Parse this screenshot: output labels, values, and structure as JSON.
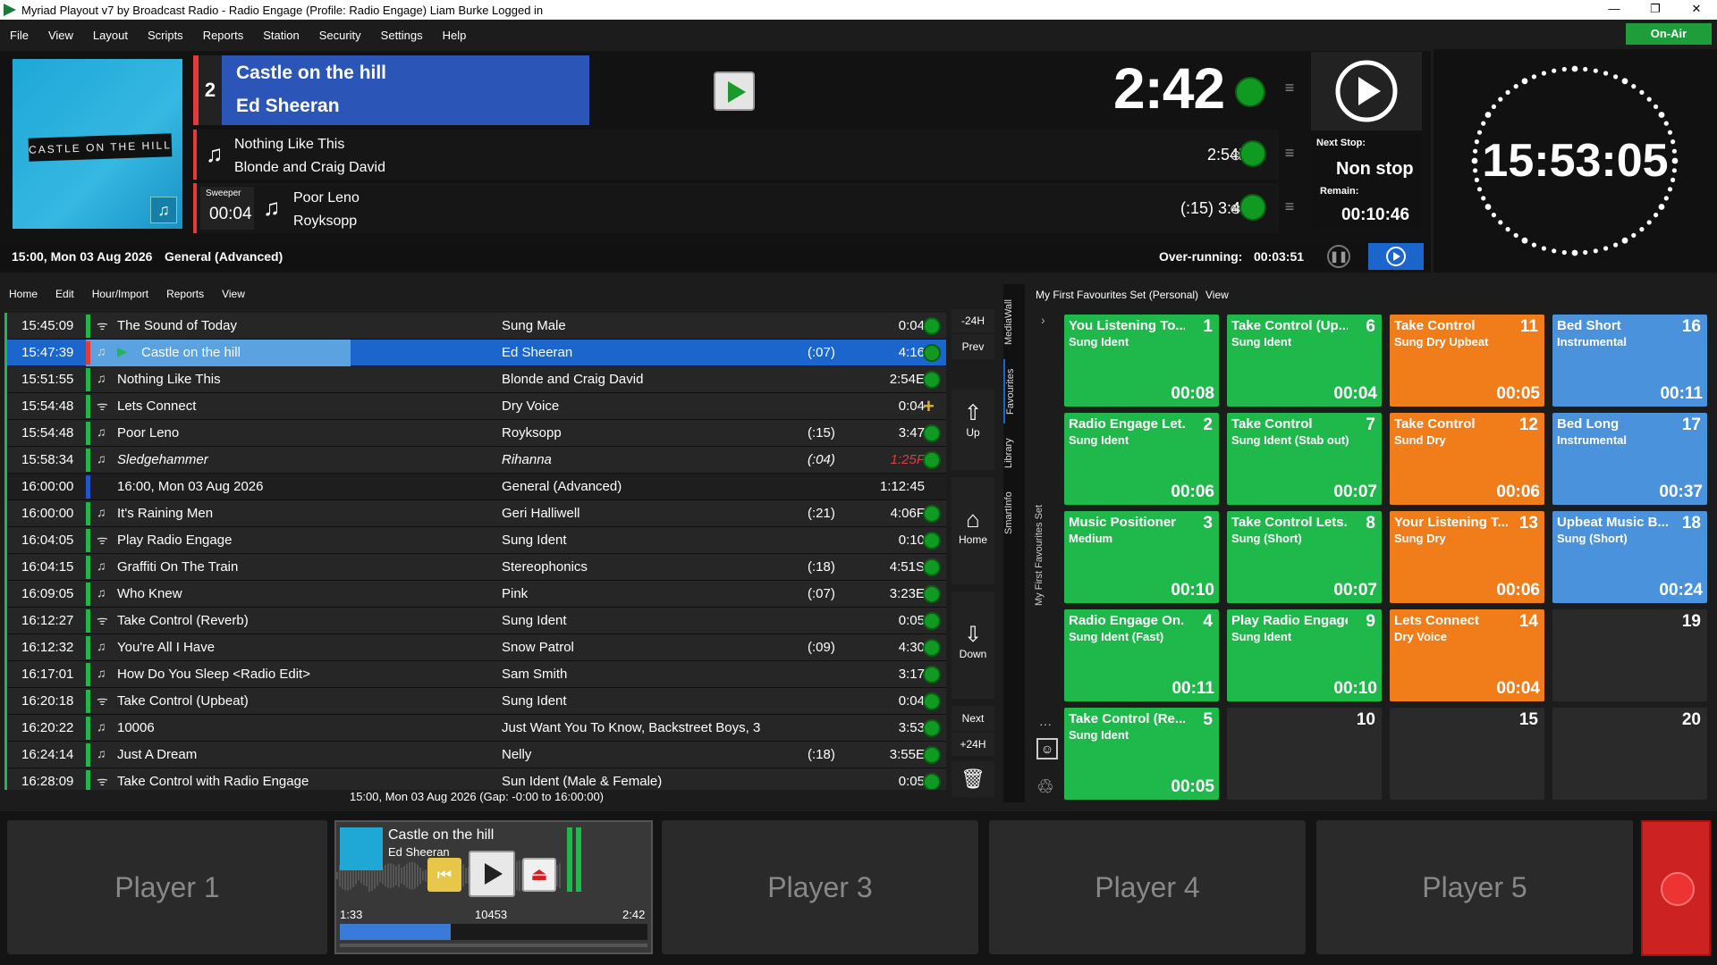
{
  "window": {
    "title": "Myriad Playout v7 by Broadcast Radio - Radio Engage (Profile: Radio Engage) Liam Burke Logged in"
  },
  "menu": [
    "File",
    "View",
    "Layout",
    "Scripts",
    "Reports",
    "Station",
    "Security",
    "Settings",
    "Help"
  ],
  "onair_label": "On-Air",
  "now_playing": {
    "number": "2",
    "title": "Castle on the hill",
    "artist": "Ed Sheeran",
    "art_text": "CASTLE ON THE HILL",
    "remaining": "2:42"
  },
  "next": [
    {
      "title": "Nothing Like This",
      "artist": "Blonde and Craig David",
      "duration": "2:54E"
    },
    {
      "title": "Poor Leno",
      "artist": "Royksopp",
      "duration": "(:15) 3:47",
      "sweeper_label": "Sweeper",
      "sweeper_time": "00:04"
    }
  ],
  "next_stop": {
    "label": "Next Stop:",
    "value": "Non stop",
    "remain_label": "Remain:",
    "remain_value": "00:10:46"
  },
  "clock": "15:53:05",
  "status": {
    "hour": "15:00, Mon 03 Aug 2026",
    "format": "General (Advanced)",
    "overrun_label": "Over-running:",
    "overrun_value": "00:03:51"
  },
  "log_menu": [
    "Home",
    "Edit",
    "Hour/Import",
    "Reports",
    "View"
  ],
  "log_rows": [
    {
      "time": "15:45:09",
      "icon": "ident",
      "title": "The Sound of Today",
      "artist": "Sung Male",
      "intro": "",
      "dur": "0:04",
      "bar": "#1fb84a",
      "state": "done"
    },
    {
      "time": "15:47:39",
      "icon": "music",
      "title": "Castle on the hill",
      "artist": "Ed Sheeran",
      "intro": "(:07)",
      "dur": "4:16",
      "bar": "#e23b3b",
      "state": "active"
    },
    {
      "time": "15:51:55",
      "icon": "music",
      "title": "Nothing Like This",
      "artist": "Blonde and Craig David",
      "intro": "",
      "dur": "2:54E",
      "bar": "#1fb84a",
      "state": ""
    },
    {
      "time": "15:54:48",
      "icon": "ident",
      "title": "Lets Connect",
      "artist": "Dry Voice",
      "intro": "",
      "dur": "0:04",
      "bar": "#1fb84a",
      "state": "plus"
    },
    {
      "time": "15:54:48",
      "icon": "music",
      "title": "Poor Leno",
      "artist": "Royksopp",
      "intro": "(:15)",
      "dur": "3:47",
      "bar": "#1fb84a",
      "state": ""
    },
    {
      "time": "15:58:34",
      "icon": "music",
      "title": "Sledgehammer",
      "artist": "Rihanna",
      "intro": "(:04)",
      "dur": "1:25F",
      "bar": "#1fb84a",
      "state": "italic"
    },
    {
      "time": "16:00:00",
      "icon": "",
      "title": "16:00, Mon 03 Aug 2026",
      "artist": "General (Advanced)",
      "intro": "",
      "dur": "1:12:45",
      "bar": "#2255cc",
      "state": "header"
    },
    {
      "time": "16:00:00",
      "icon": "music",
      "title": "It's Raining Men",
      "artist": "Geri Halliwell",
      "intro": "(:21)",
      "dur": "4:06F",
      "bar": "#1fb84a",
      "state": ""
    },
    {
      "time": "16:04:05",
      "icon": "ident",
      "title": "Play Radio Engage",
      "artist": "Sung Ident",
      "intro": "",
      "dur": "0:10",
      "bar": "#1fb84a",
      "state": ""
    },
    {
      "time": "16:04:15",
      "icon": "music",
      "title": "Graffiti On The Train",
      "artist": "Stereophonics",
      "intro": "(:18)",
      "dur": "4:51S",
      "bar": "#1fb84a",
      "state": ""
    },
    {
      "time": "16:09:05",
      "icon": "music",
      "title": "Who Knew",
      "artist": "Pink",
      "intro": "(:07)",
      "dur": "3:23E",
      "bar": "#1fb84a",
      "state": ""
    },
    {
      "time": "16:12:27",
      "icon": "ident",
      "title": "Take Control (Reverb)",
      "artist": "Sung Ident",
      "intro": "",
      "dur": "0:05",
      "bar": "#1fb84a",
      "state": ""
    },
    {
      "time": "16:12:32",
      "icon": "music",
      "title": "You're All I Have",
      "artist": "Snow Patrol",
      "intro": "(:09)",
      "dur": "4:30",
      "bar": "#1fb84a",
      "state": ""
    },
    {
      "time": "16:17:01",
      "icon": "music",
      "title": "How Do You Sleep <Radio Edit>",
      "artist": "Sam Smith",
      "intro": "",
      "dur": "3:17",
      "bar": "#1fb84a",
      "state": ""
    },
    {
      "time": "16:20:18",
      "icon": "ident",
      "title": "Take Control (Upbeat)",
      "artist": "Sung Ident",
      "intro": "",
      "dur": "0:04",
      "bar": "#1fb84a",
      "state": ""
    },
    {
      "time": "16:20:22",
      "icon": "music",
      "title": "10006",
      "artist": "Just Want You To Know, Backstreet Boys, 3",
      "intro": "",
      "dur": "3:53",
      "bar": "#1fb84a",
      "state": ""
    },
    {
      "time": "16:24:14",
      "icon": "music",
      "title": "Just A Dream",
      "artist": "Nelly",
      "intro": "(:18)",
      "dur": "3:55E",
      "bar": "#1fb84a",
      "state": ""
    },
    {
      "time": "16:28:09",
      "icon": "ident",
      "title": "Take Control with Radio Engage",
      "artist": "Sun Ident (Male & Female)",
      "intro": "",
      "dur": "0:05",
      "bar": "#1fb84a",
      "state": ""
    }
  ],
  "log_footer": "15:00, Mon 03 Aug 2026 (Gap: -0:00 to 16:00:00)",
  "nav": {
    "minus24": "-24H",
    "prev": "Prev",
    "up": "Up",
    "home": "Home",
    "down": "Down",
    "next": "Next",
    "plus24": "+24H"
  },
  "mediawall": {
    "tabs": [
      "MediaWall",
      "Favourites",
      "Library",
      "SmartInfo"
    ],
    "set_label": "My First Favourites Set",
    "header": "My First Favourites Set (Personal)",
    "view": "View",
    "tiles": [
      {
        "n": "1",
        "title": "You Listening To...",
        "sub": "Sung Ident",
        "dur": "00:08",
        "color": "g"
      },
      {
        "n": "2",
        "title": "Radio Engage Let...",
        "sub": "Sung Ident",
        "dur": "00:06",
        "color": "g"
      },
      {
        "n": "3",
        "title": "Music Positioner",
        "sub": "Medium",
        "dur": "00:10",
        "color": "g"
      },
      {
        "n": "4",
        "title": "Radio Engage On...",
        "sub": "Sung Ident (Fast)",
        "dur": "00:11",
        "color": "g"
      },
      {
        "n": "5",
        "title": "Take Control (Re...",
        "sub": "Sung Ident",
        "dur": "00:05",
        "color": "g"
      },
      {
        "n": "6",
        "title": "Take Control (Up...",
        "sub": "Sung Ident",
        "dur": "00:04",
        "color": "g"
      },
      {
        "n": "7",
        "title": "Take Control",
        "sub": "Sung Ident (Stab out)",
        "dur": "00:07",
        "color": "g"
      },
      {
        "n": "8",
        "title": "Take Control Lets...",
        "sub": "Sung (Short)",
        "dur": "00:07",
        "color": "g"
      },
      {
        "n": "9",
        "title": "Play Radio Engage",
        "sub": "Sung Ident",
        "dur": "00:10",
        "color": "g"
      },
      {
        "n": "10",
        "title": "",
        "sub": "",
        "dur": "",
        "color": "e"
      },
      {
        "n": "11",
        "title": "Take Control",
        "sub": "Sung Dry Upbeat",
        "dur": "00:05",
        "color": "o"
      },
      {
        "n": "12",
        "title": "Take Control",
        "sub": "Sund Dry",
        "dur": "00:06",
        "color": "o"
      },
      {
        "n": "13",
        "title": "Your Listening T...",
        "sub": "Sung Dry",
        "dur": "00:06",
        "color": "o"
      },
      {
        "n": "14",
        "title": "Lets Connect",
        "sub": "Dry Voice",
        "dur": "00:04",
        "color": "o"
      },
      {
        "n": "15",
        "title": "",
        "sub": "",
        "dur": "",
        "color": "e"
      },
      {
        "n": "16",
        "title": "Bed Short",
        "sub": "Instrumental",
        "dur": "00:11",
        "color": "b"
      },
      {
        "n": "17",
        "title": "Bed Long",
        "sub": "Instrumental",
        "dur": "00:37",
        "color": "b"
      },
      {
        "n": "18",
        "title": "Upbeat Music B...",
        "sub": "Sung (Short)",
        "dur": "00:24",
        "color": "b"
      },
      {
        "n": "19",
        "title": "",
        "sub": "",
        "dur": "",
        "color": "e"
      },
      {
        "n": "20",
        "title": "",
        "sub": "",
        "dur": "",
        "color": "e"
      }
    ]
  },
  "players": {
    "p1": "Player 1",
    "p3": "Player 3",
    "p4": "Player 4",
    "p5": "Player 5",
    "p2": {
      "title": "Castle on the hill",
      "artist": "Ed Sheeran",
      "elapsed": "1:33",
      "id": "10453",
      "remain": "2:42",
      "progress": 0.36
    }
  }
}
